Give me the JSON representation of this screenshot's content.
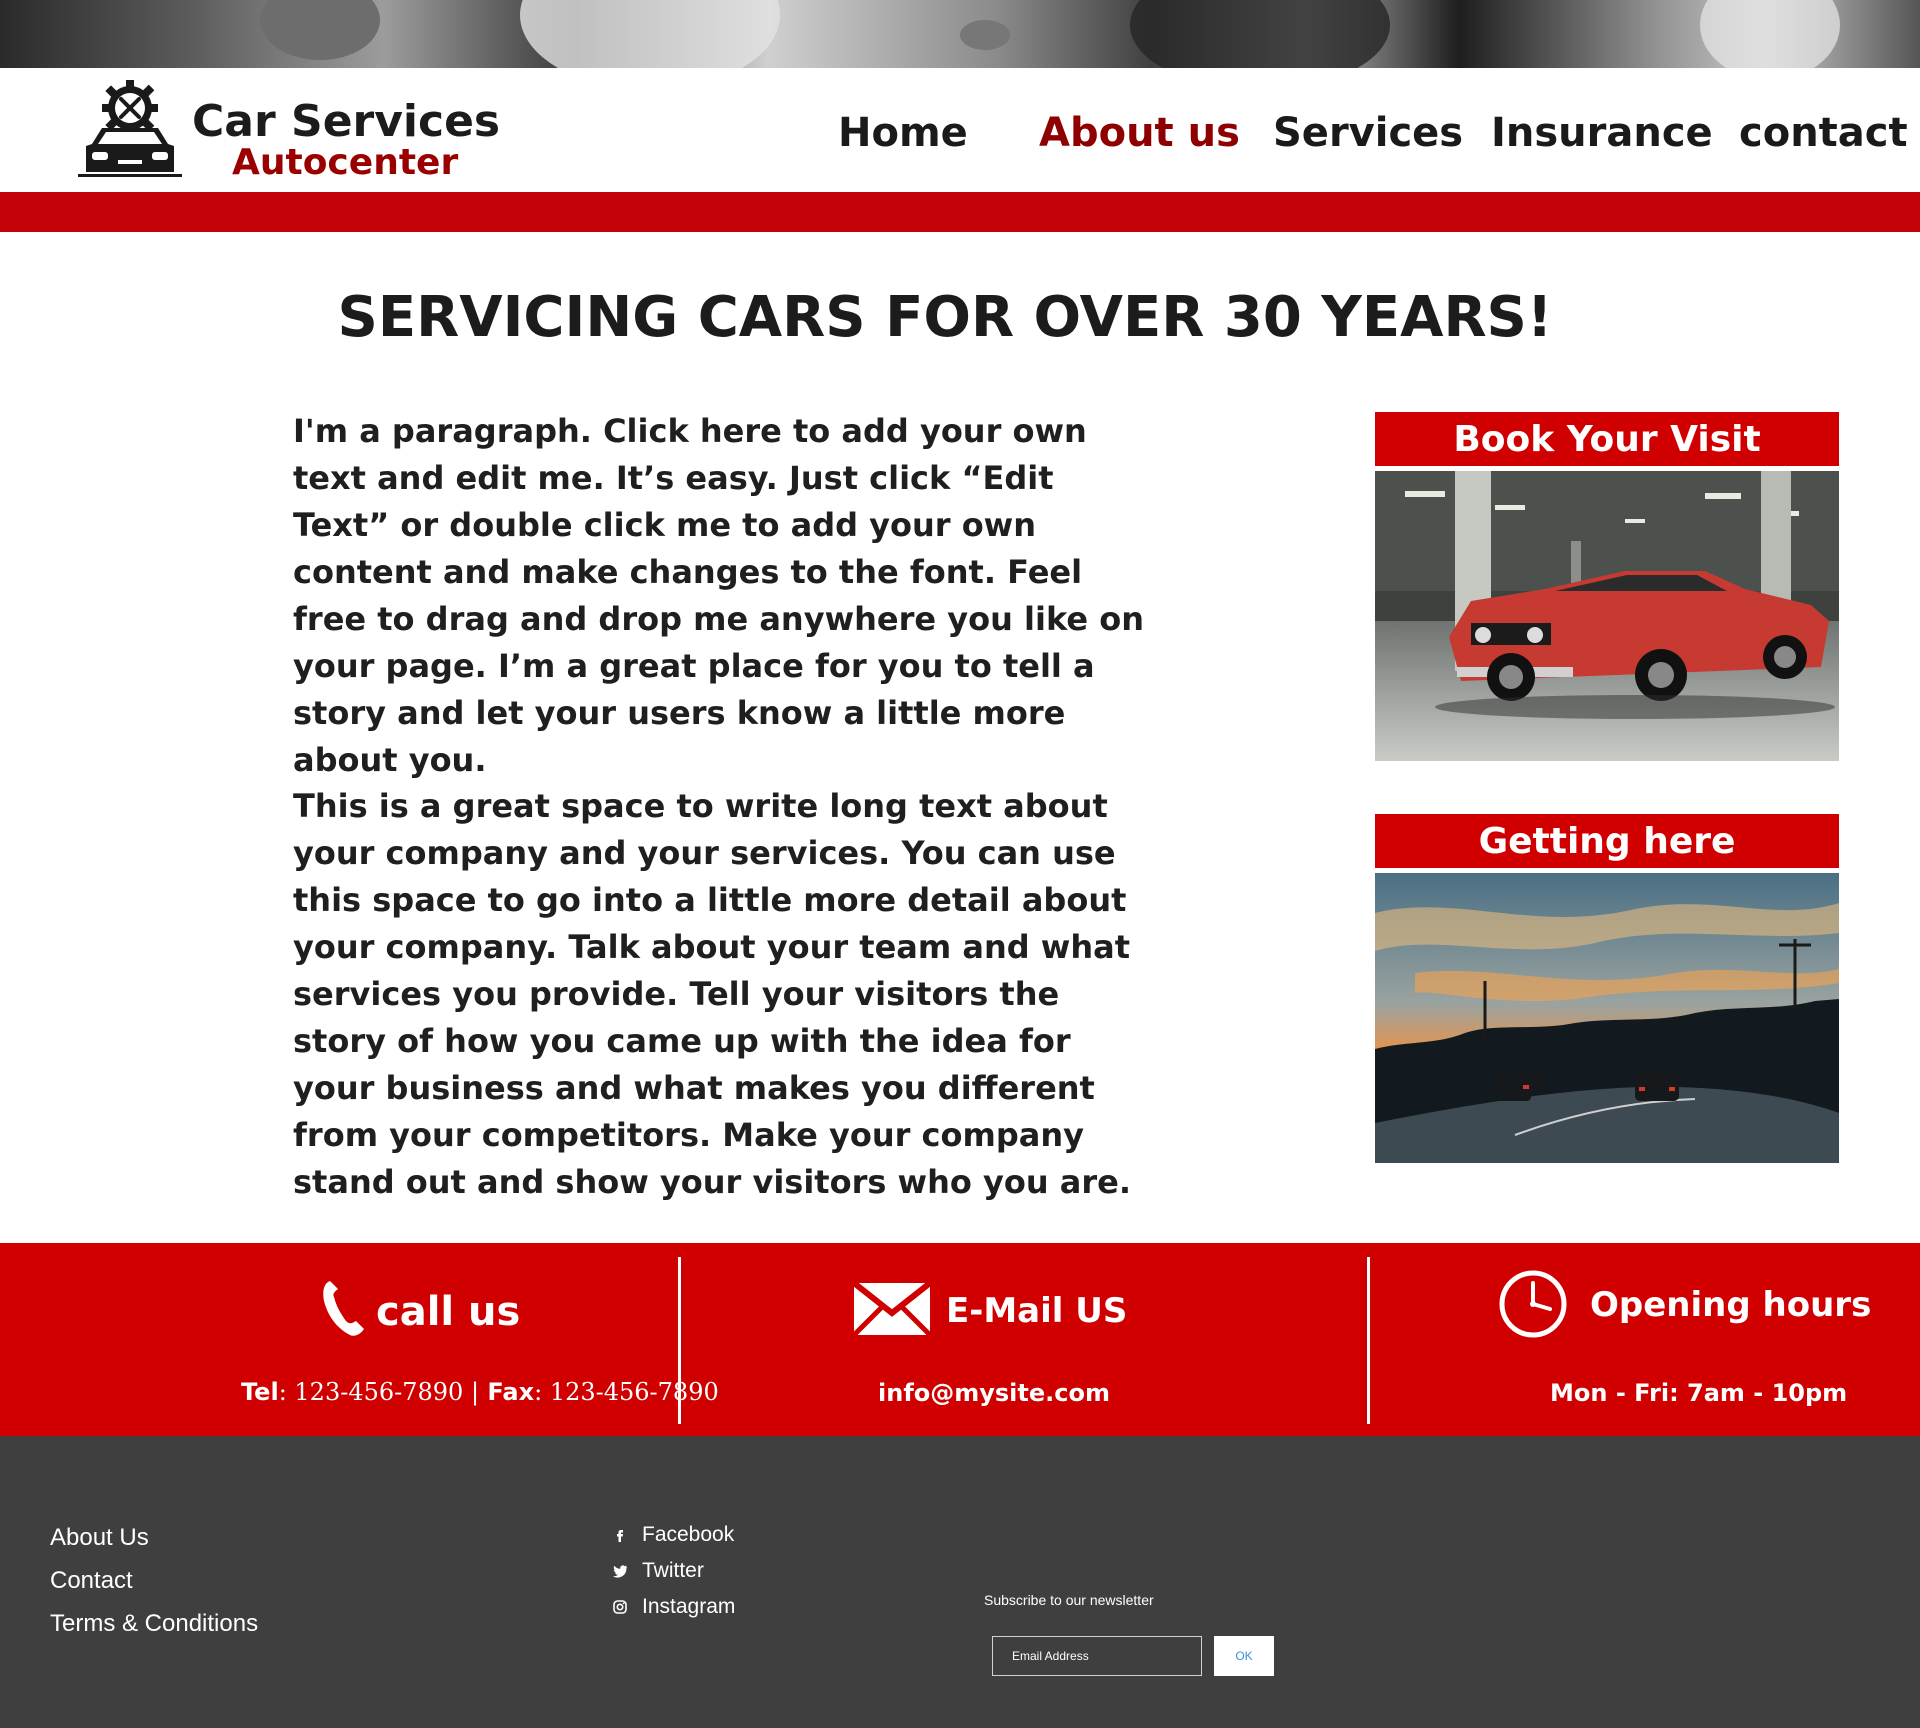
{
  "brand": {
    "name": "Car Services",
    "subname": "Autocenter",
    "accent_color": "#c40008",
    "dark_red": "#8f0000",
    "logo_icon": "car-gear-wrench-icon"
  },
  "nav": {
    "items": [
      {
        "label": "Home",
        "active": false
      },
      {
        "label": "About us",
        "active": true
      },
      {
        "label": "Services",
        "active": false
      },
      {
        "label": "Insurance",
        "active": false
      },
      {
        "label": "contact",
        "active": false
      }
    ]
  },
  "main": {
    "headline": "SERVICING CARS FOR OVER  30 YEARS!",
    "paragraph_1": "I'm a paragraph. Click here to add your own text and edit me. It’s easy. Just click “Edit Text” or double click me to add your own content and make changes to the font. Feel free to drag and drop me anywhere you like on your page. I’m a great place for you to tell a story and let your users know a little more about you.",
    "paragraph_2": "This is a great space to write long text about your company and your services. You can use this space to go into a little more detail about your company. Talk about your team and what services you provide. Tell your visitors the story of how you came up with the idea for your business and what makes you different from your competitors. Make your company stand out and show your visitors who you are."
  },
  "cards": [
    {
      "title": "Book Your Visit",
      "image": "red-muscle-car-in-parking-garage"
    },
    {
      "title": "Getting here",
      "image": "highway-at-sunset"
    }
  ],
  "contact": {
    "call": {
      "title": "call us",
      "icon": "phone-icon",
      "tel_label": "Tel",
      "tel": "123-456-7890",
      "separator": "|",
      "fax_label": "Fax",
      "fax": "123-456-7890"
    },
    "email": {
      "title": "E-Mail US",
      "icon": "envelope-icon",
      "address": "info@mysite.com"
    },
    "hours": {
      "title": "Opening hours",
      "icon": "clock-icon",
      "days": "Mon - Fri",
      "time": "7am - 10pm"
    }
  },
  "footer": {
    "links": [
      "About Us",
      "Contact",
      "Terms & Conditions"
    ],
    "social": [
      {
        "label": "Facebook",
        "icon": "facebook-icon"
      },
      {
        "label": "Twitter",
        "icon": "twitter-icon"
      },
      {
        "label": "Instagram",
        "icon": "instagram-icon"
      }
    ],
    "newsletter": {
      "label": "Subscribe to our newsletter",
      "placeholder": "Email Address",
      "button": "OK"
    },
    "background": "#3f3f3f"
  }
}
